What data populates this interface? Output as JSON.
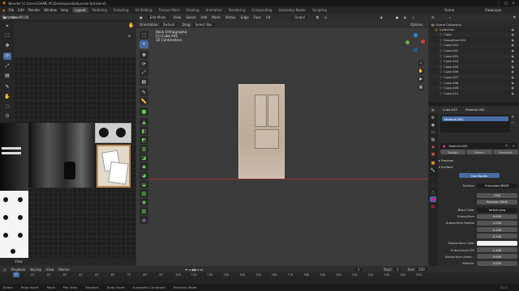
{
  "app": {
    "name": "Blender",
    "title": "Blender [C:\\Users\\GAME PC\\Desktop\\sedol\\Leveln-fall.blend]",
    "version": "3.2.1"
  },
  "menubar": {
    "menus": [
      "File",
      "Edit",
      "Render",
      "Window",
      "Help"
    ],
    "workspaces": [
      "Layout",
      "Modeling",
      "Sculpting",
      "UV Editing",
      "Texture Paint",
      "Shading",
      "Animation",
      "Rendering",
      "Compositing",
      "Geometry Nodes",
      "Scripting"
    ],
    "active_workspace": "Layout",
    "scene": "Scene",
    "view_layer": "ViewLayer"
  },
  "uv_editor": {
    "rotation_label": "Rotation: -90.00",
    "view_menu": "View"
  },
  "viewport": {
    "mode": "Edit Mode",
    "orientation_label": "Orientation:",
    "orientation_value": "Default",
    "drag_label": "Drag:",
    "drag_value": "Select Box",
    "transform": "Global",
    "options": "Options",
    "info_line1": "Back Orthographic",
    "info_line2": "(1) Cube.042",
    "info_line3": "10 Centimeters"
  },
  "outliner": {
    "title": "Scene Collection",
    "rows": [
      "Collection",
      "Cube",
      "Smoothed.001",
      "Cube.001",
      "Cube.002",
      "Cube.003",
      "Cube.004",
      "Cube.005",
      "Cube.006",
      "Cube.007",
      "Cube.008",
      "Cube.009",
      "Cube.010"
    ]
  },
  "properties": {
    "object": "Cube.042",
    "material": "Material.061",
    "slot": "Material.061",
    "material_name": "Material.061",
    "buttons": [
      "Assign",
      "Select",
      "Deselect"
    ],
    "panel_preview": "Preview",
    "panel_surface": "Surface",
    "use_nodes": "Use Nodes",
    "surface_label": "Surface",
    "surface_value": "Principled BSDF",
    "dist": "GGX",
    "sss_method": "Random Walk",
    "base_color_label": "Base Color",
    "base_color_value": "fortpic.png",
    "rows": [
      {
        "label": "Subsurface",
        "value": "0.000"
      },
      {
        "label": "Subsurface Radius",
        "value": "1.000"
      },
      {
        "label": "",
        "value": "0.200"
      },
      {
        "label": "",
        "value": "0.100"
      },
      {
        "label": "Subsurface Color",
        "value": ""
      },
      {
        "label": "Subsurface IOR",
        "value": "1.400"
      },
      {
        "label": "Subsurface Aniso...",
        "value": "0.000"
      },
      {
        "label": "Metallic",
        "value": "0.000"
      },
      {
        "label": "Specular",
        "value": "0.500"
      },
      {
        "label": "Specular Tint",
        "value": "0.000"
      },
      {
        "label": "Roughness",
        "value": "0.500"
      }
    ]
  },
  "timeline": {
    "menus": [
      "Playback",
      "Keying",
      "View",
      "Marker"
    ],
    "current_frame": "1",
    "start_label": "Start",
    "start": "1",
    "end_label": "End",
    "end": "250",
    "ticks": [
      "0",
      "10",
      "20",
      "30",
      "40",
      "50",
      "60",
      "70",
      "80",
      "90",
      "100",
      "110",
      "120",
      "130",
      "140",
      "150",
      "160",
      "170",
      "180",
      "190",
      "200",
      "210",
      "220",
      "230",
      "240",
      "250"
    ]
  },
  "statusbar": {
    "items": [
      "Select",
      "Snap Invert",
      "Move",
      "Pan View",
      "Trackball",
      "Snap Invert",
      "Automatic Constraint",
      "Precision Mode"
    ]
  },
  "colors": {
    "accent": "#476ca4",
    "axis_red": "#9b3333",
    "orange": "#e08a2a"
  }
}
